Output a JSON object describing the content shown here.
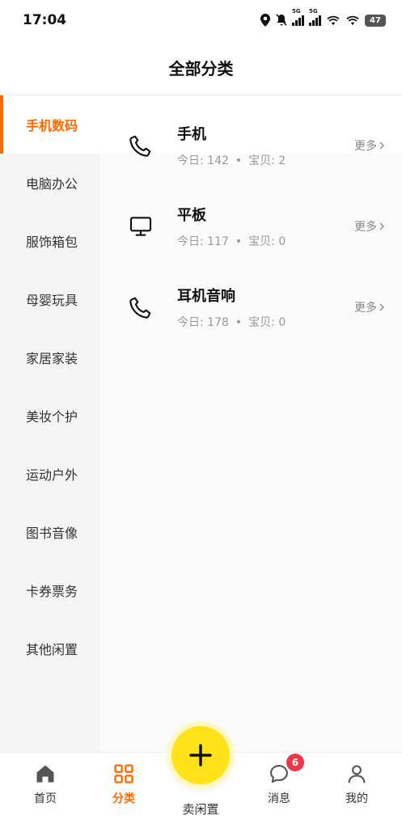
{
  "status_bar": {
    "time": "17:04",
    "battery": "47",
    "network_1": "5G",
    "network_2": "5G"
  },
  "header": {
    "title": "全部分类"
  },
  "sidebar": {
    "items": [
      {
        "label": "手机数码",
        "active": true
      },
      {
        "label": "电脑办公"
      },
      {
        "label": "服饰箱包"
      },
      {
        "label": "母婴玩具"
      },
      {
        "label": "家居家装"
      },
      {
        "label": "美妆个护"
      },
      {
        "label": "运动户外"
      },
      {
        "label": "图书音像"
      },
      {
        "label": "卡券票务"
      },
      {
        "label": "其他闲置"
      }
    ]
  },
  "categories": [
    {
      "name": "手机",
      "today": "今日: 142",
      "items": "宝贝: 2",
      "more": "更多",
      "icon": "phone-icon"
    },
    {
      "name": "平板",
      "today": "今日: 117",
      "items": "宝贝: 0",
      "more": "更多",
      "icon": "monitor-icon"
    },
    {
      "name": "耳机音响",
      "today": "今日: 178",
      "items": "宝贝: 0",
      "more": "更多",
      "icon": "phone-icon"
    }
  ],
  "meta_separator": "•",
  "tabbar": {
    "home": "首页",
    "category": "分类",
    "sell": "卖闲置",
    "messages": "消息",
    "messages_badge": "6",
    "mine": "我的"
  },
  "colors": {
    "accent": "#ff6a00",
    "fab": "#ffe21a",
    "badge": "#f2364a"
  }
}
